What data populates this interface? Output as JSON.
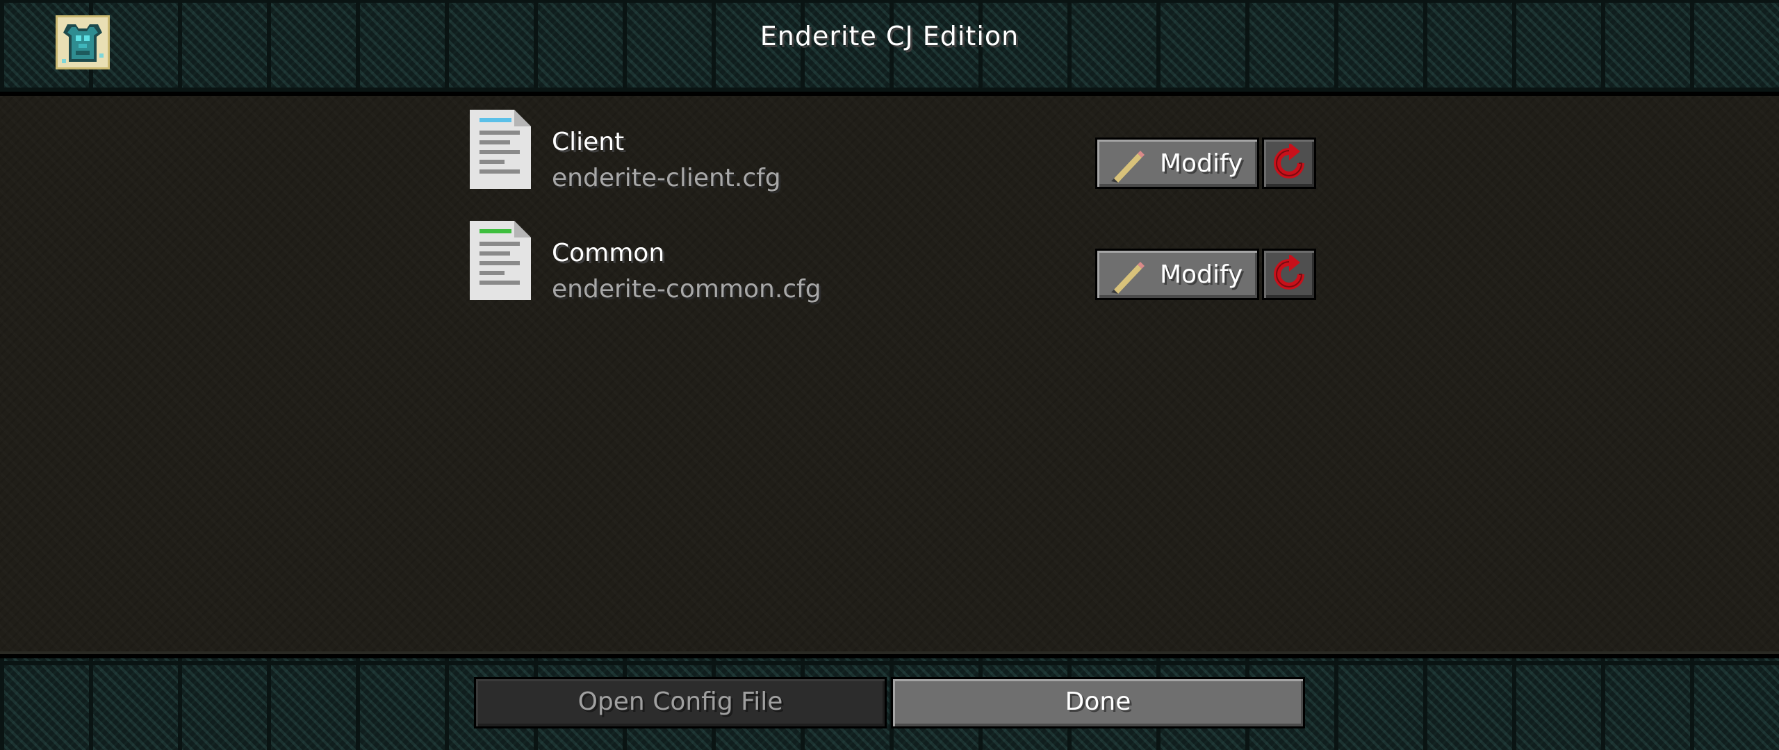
{
  "header": {
    "title": "Enderite CJ Edition",
    "logo_icon": "enderite-chestplate-icon"
  },
  "configs": [
    {
      "title": "Client",
      "file": "enderite-client.cfg",
      "accent": "#5bc0e8",
      "modify_label": "Modify",
      "reset_icon": "reset-icon"
    },
    {
      "title": "Common",
      "file": "enderite-common.cfg",
      "accent": "#3fbf3f",
      "modify_label": "Modify",
      "reset_icon": "reset-icon"
    }
  ],
  "footer": {
    "open_config_label": "Open Config File",
    "done_label": "Done"
  },
  "colors": {
    "reset_red": "#c8101a",
    "button_gray": "#6f6f6f",
    "tile_teal": "#0e1a19"
  }
}
